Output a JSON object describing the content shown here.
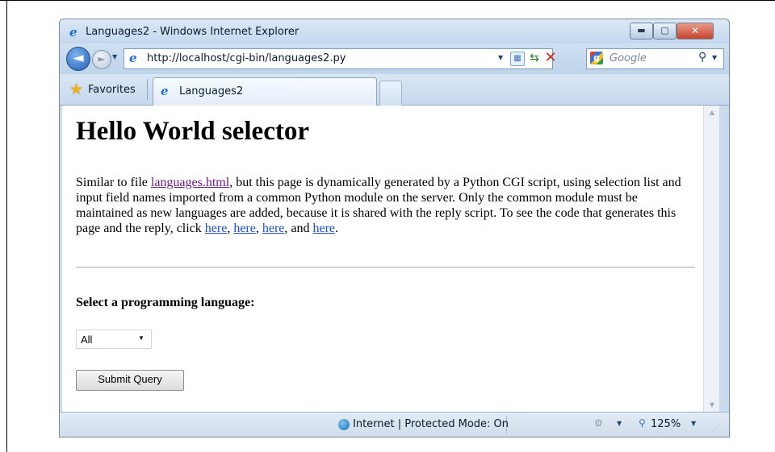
{
  "window": {
    "title": "Languages2 - Windows Internet Explorer",
    "min_glyph": "▬",
    "max_glyph": "▢",
    "close_glyph": "✕"
  },
  "address": {
    "url": "http://localhost/cgi-bin/languages2.py"
  },
  "search": {
    "placeholder": "Google"
  },
  "toolbar": {
    "favorites_label": "Favorites",
    "tab_label": "Languages2"
  },
  "page": {
    "title": "Hello World selector",
    "intro_before_link": "Similar to file ",
    "intro_link": "languages.html",
    "intro_after_link": ", but this page is dynamically generated by a Python CGI script, using selection list and input field names imported from a common Python module on the server. Only the common module must be maintained as new languages are added, because it is shared with the reply script. To see the code that generates this page and the reply, click ",
    "here_links": [
      "here",
      "here",
      "here",
      "here"
    ],
    "sep_comma": ", ",
    "sep_and": ", and ",
    "period": ".",
    "select_label": "Select a programming language:",
    "select_value": "All",
    "submit_label": "Submit Query"
  },
  "status": {
    "zone": "Internet | Protected Mode: On",
    "zoom": "125%"
  },
  "colors": {
    "link": "#1a4fd6",
    "visited_link": "#6e1a8a",
    "chrome": "#c9dcee"
  }
}
